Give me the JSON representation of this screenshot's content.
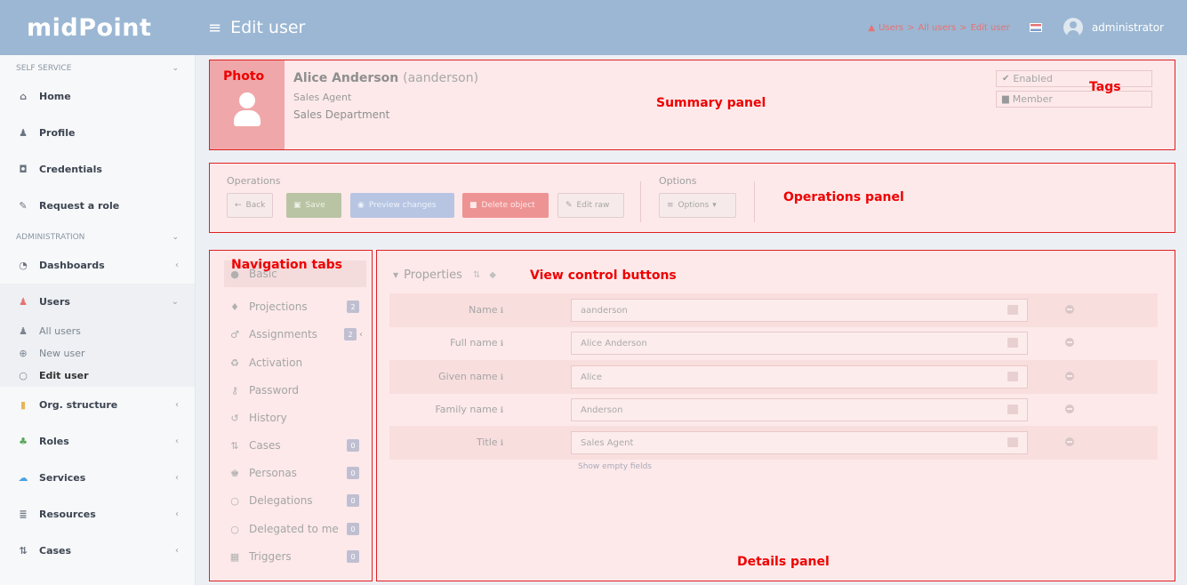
{
  "header": {
    "logo": "midPoint",
    "menu_icon": "≡",
    "page_title": "Edit user",
    "breadcrumb": [
      "Users",
      "All users",
      "Edit user"
    ],
    "breadcrumb_sep": ">",
    "user": "administrator"
  },
  "sidebar": {
    "self_service_header": "SELF SERVICE",
    "self_service_items": [
      {
        "icon": "home-icon",
        "label": "Home"
      },
      {
        "icon": "user-icon",
        "label": "Profile"
      },
      {
        "icon": "shield-icon",
        "label": "Credentials"
      },
      {
        "icon": "edit-icon",
        "label": "Request a role"
      }
    ],
    "administration_header": "ADMINISTRATION",
    "admin_items": [
      {
        "icon": "dashboard-icon",
        "label": "Dashboards"
      },
      {
        "icon": "user-icon",
        "label": "Users"
      }
    ],
    "users_subitems": [
      {
        "icon": "user-icon",
        "label": "All users"
      },
      {
        "icon": "plus-circle-icon",
        "label": "New user"
      },
      {
        "icon": "circle-icon",
        "label": "Edit user"
      }
    ],
    "admin_items_after": [
      {
        "icon": "building-icon",
        "label": "Org. structure"
      },
      {
        "icon": "sitemap-icon",
        "label": "Roles"
      },
      {
        "icon": "cloud-icon",
        "label": "Services"
      },
      {
        "icon": "database-icon",
        "label": "Resources"
      },
      {
        "icon": "cases-icon",
        "label": "Cases"
      }
    ]
  },
  "summary": {
    "name": "Alice Anderson",
    "oid": "(aanderson)",
    "title": "Sales Agent",
    "department": "Sales Department",
    "tags": [
      "Enabled",
      "Member"
    ]
  },
  "operations": {
    "label": "Operations",
    "buttons": {
      "back": "Back",
      "save": "Save",
      "preview": "Preview changes",
      "delete": "Delete object",
      "edit_raw": "Edit raw"
    },
    "options_label": "Options",
    "options_button": "Options"
  },
  "nav_tabs": [
    {
      "icon": "circle-icon",
      "label": "Basic",
      "badge": null
    },
    {
      "icon": "projection-icon",
      "label": "Projections",
      "badge": "2"
    },
    {
      "icon": "assignment-icon",
      "label": "Assignments",
      "badge": "2"
    },
    {
      "icon": "activation-icon",
      "label": "Activation",
      "badge": null
    },
    {
      "icon": "key-icon",
      "label": "Password",
      "badge": null
    },
    {
      "icon": "history-icon",
      "label": "History",
      "badge": null
    },
    {
      "icon": "cases-icon",
      "label": "Cases",
      "badge": "0"
    },
    {
      "icon": "personas-icon",
      "label": "Personas",
      "badge": "0"
    },
    {
      "icon": "circle-icon",
      "label": "Delegations",
      "badge": "0"
    },
    {
      "icon": "circle-icon",
      "label": "Delegated to me",
      "badge": "0"
    },
    {
      "icon": "calendar-icon",
      "label": "Triggers",
      "badge": "0"
    }
  ],
  "details": {
    "section_title": "Properties",
    "rows": [
      {
        "label": "Name",
        "value": "aanderson"
      },
      {
        "label": "Full name",
        "value": "Alice Anderson"
      },
      {
        "label": "Given name",
        "value": "Alice"
      },
      {
        "label": "Family name",
        "value": "Anderson"
      },
      {
        "label": "Title",
        "value": "Sales Agent"
      }
    ],
    "show_empty": "Show empty fields"
  },
  "annotations": {
    "photo": "Photo",
    "summary": "Summary panel",
    "tags": "Tags",
    "operations": "Operations panel",
    "navigation": "Navigation tabs",
    "view_control": "View control buttons",
    "details": "Details panel"
  },
  "colors": {
    "header": "#9bb7d3",
    "annotation": "#ee0000",
    "panel_fill": "#fde9ea"
  }
}
